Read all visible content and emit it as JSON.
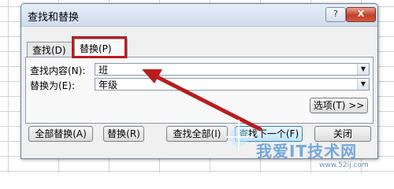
{
  "dialog": {
    "title": "查找和替换",
    "help_label": "?",
    "close_label": "X"
  },
  "tabs": [
    {
      "label": "查找(D)"
    },
    {
      "label": "替换(P)"
    }
  ],
  "form": {
    "find_label": "查找内容(N):",
    "find_value": "班",
    "replace_label": "替换为(E):",
    "replace_value": "年级",
    "options_label": "选项(T) >>"
  },
  "buttons": {
    "replace_all": "全部替换(A)",
    "replace": "替换(R)",
    "find_all": "查找全部(I)",
    "find_next": "查找下一个(F)",
    "close": "关闭"
  },
  "watermark": {
    "text": "我爱IT技术网",
    "url": "www.52ij.com"
  },
  "colors": {
    "annotation": "#b81d1d",
    "watermark": "#4d8fd6"
  }
}
